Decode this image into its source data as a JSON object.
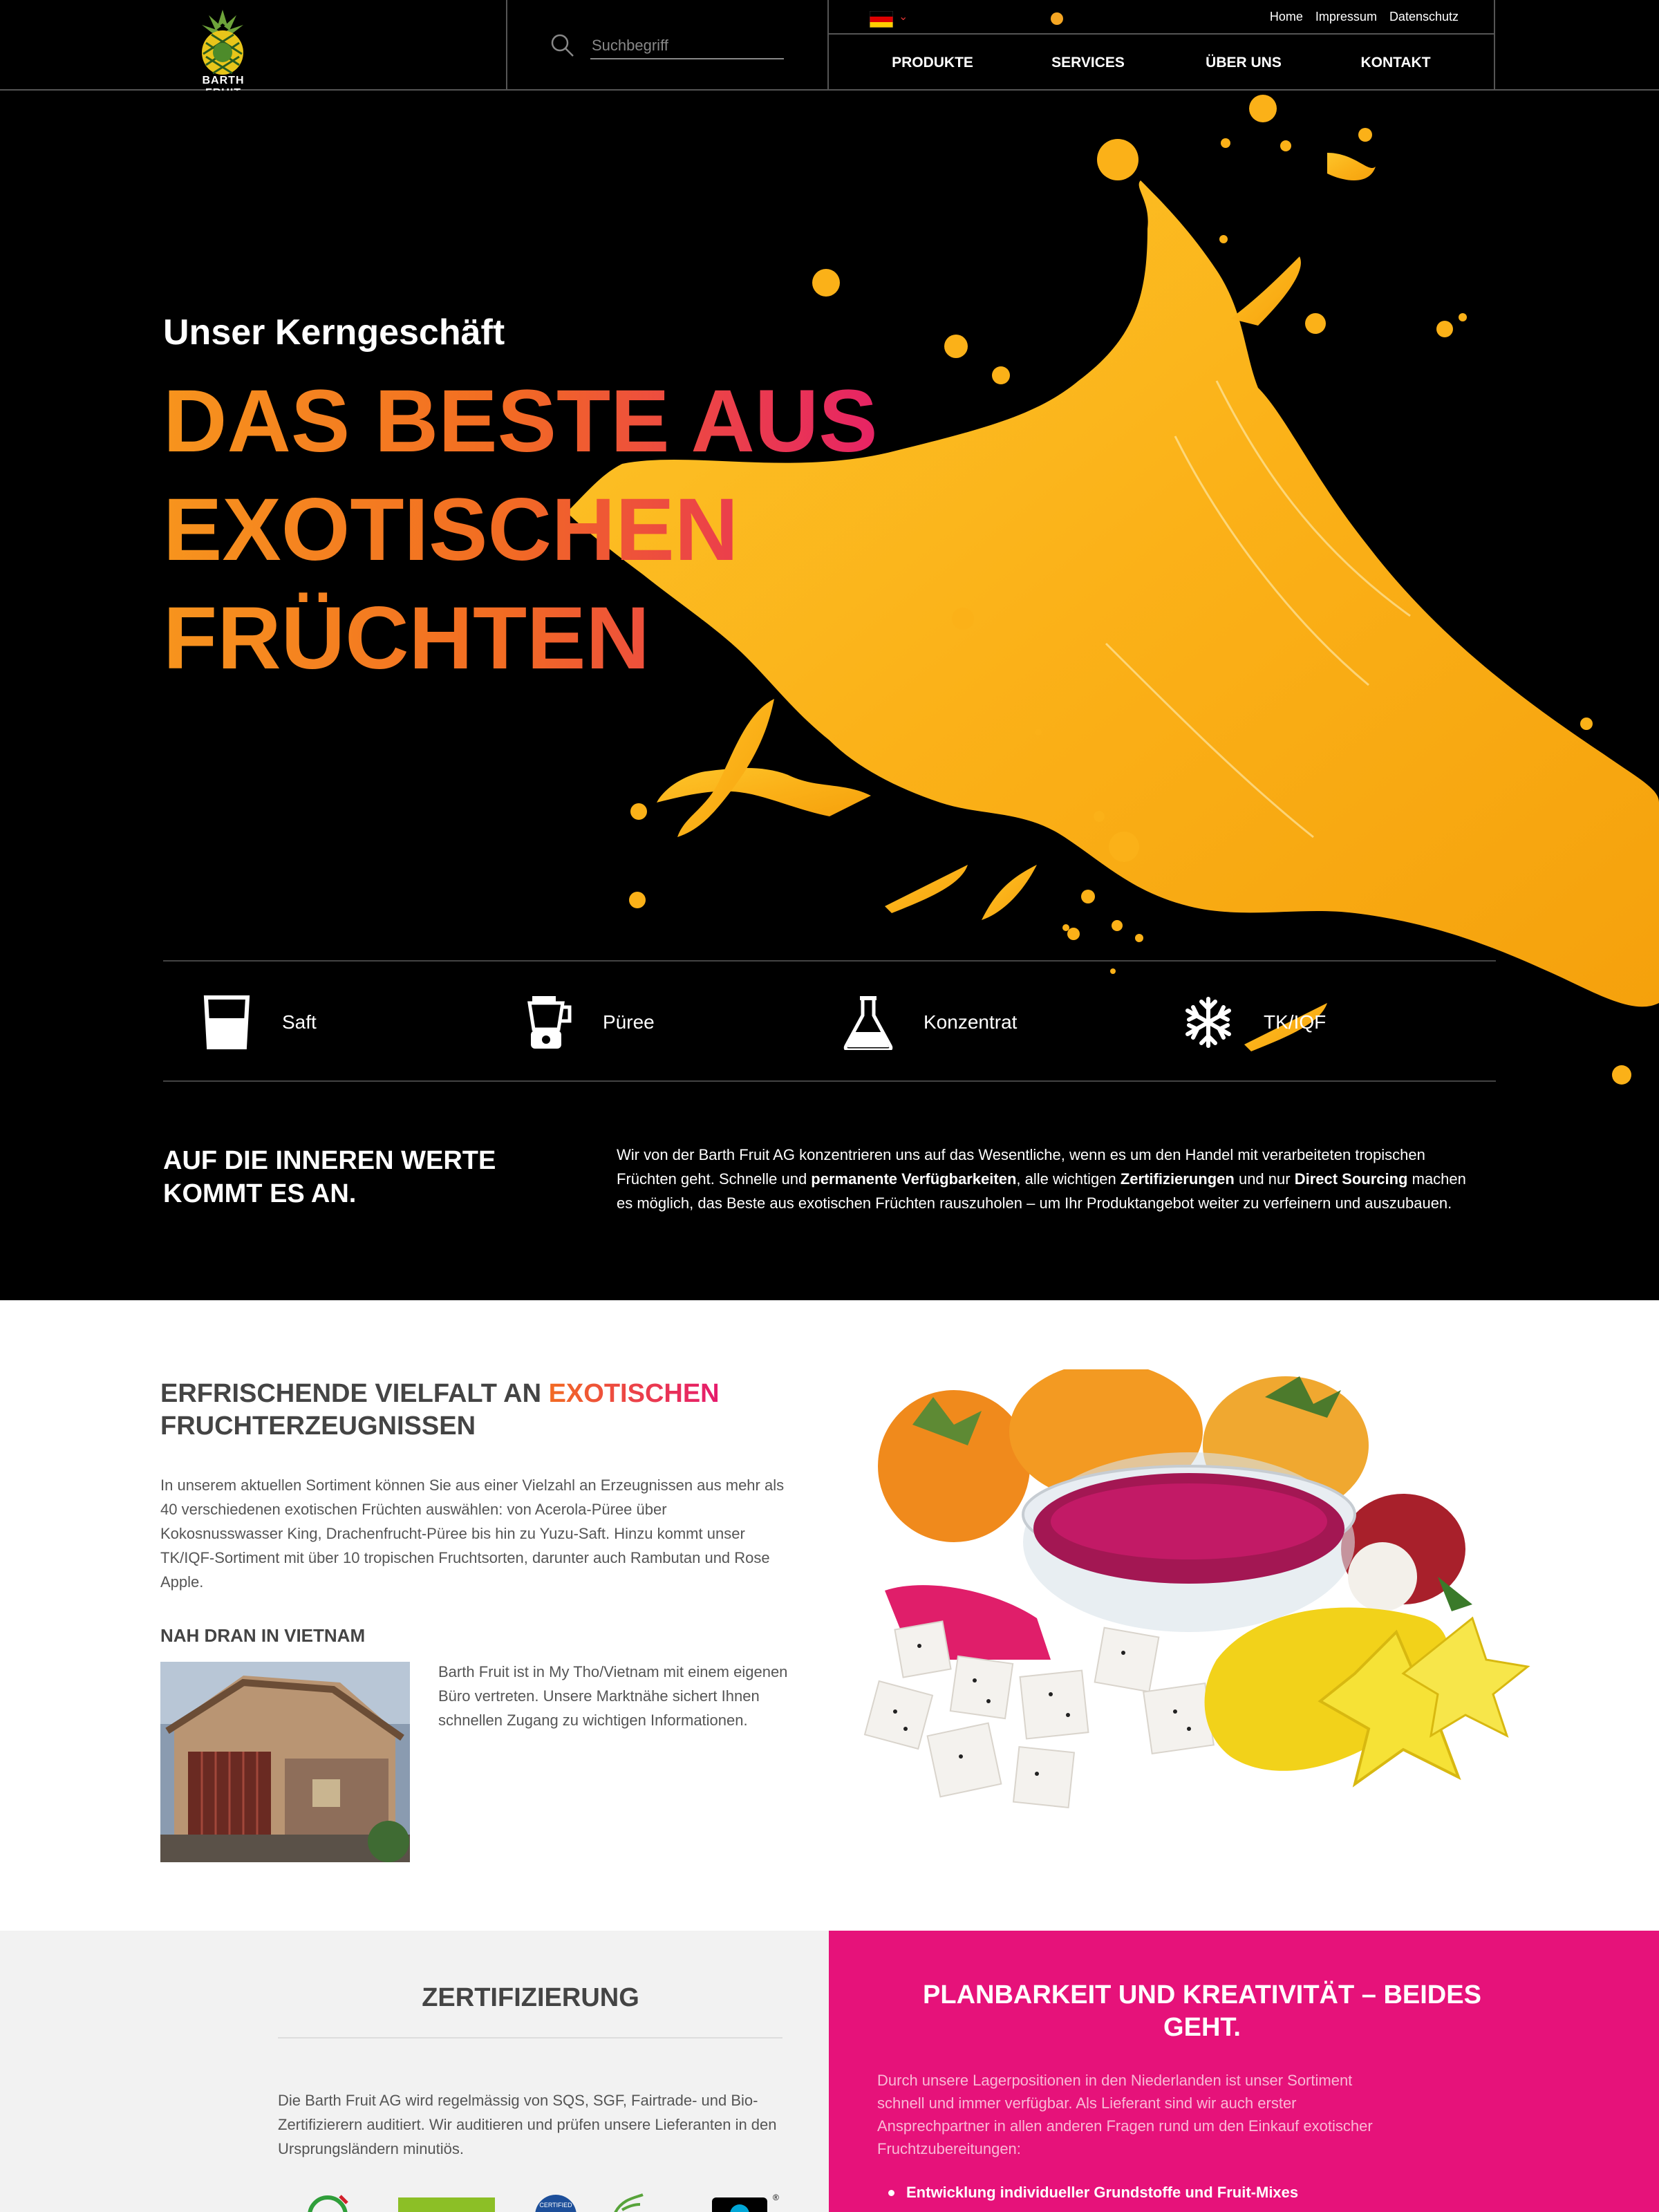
{
  "header": {
    "logo_text": "BARTH FRUIT",
    "search_placeholder": "Suchbegriff",
    "top_links": [
      "Home",
      "Impressum",
      "Datenschutz"
    ],
    "nav": [
      "PRODUKTE",
      "SERVICES",
      "ÜBER UNS",
      "KONTAKT"
    ]
  },
  "hero": {
    "subtitle": "Unser Kerngeschäft",
    "title_lines": [
      "DAS BESTE AUS",
      "EXOTISCHEN",
      "FRÜCHTEN"
    ]
  },
  "products": [
    {
      "label": "Saft",
      "icon": "glass-icon"
    },
    {
      "label": "Püree",
      "icon": "blender-icon"
    },
    {
      "label": "Konzentrat",
      "icon": "flask-icon"
    },
    {
      "label": "TK/IQF",
      "icon": "snowflake-icon"
    }
  ],
  "inner_values": {
    "heading": "AUF DIE INNEREN WERTE KOMMT ES AN.",
    "text_1": "Wir von der Barth Fruit AG konzentrieren uns auf das Wesentliche, wenn es um den Handel mit verarbeiteten tropischen Früchten geht. Schnelle und ",
    "bold_1": "permanente Verfügbarkeiten",
    "text_2": ", alle wichtigen ",
    "bold_2": "Zertifizierungen",
    "text_3": " und nur ",
    "bold_3": "Direct Sourcing",
    "text_4": " machen es möglich, das Beste aus exotischen Früchten rauszuholen – um Ihr Produktangebot weiter zu verfeinern und auszubauen."
  },
  "variety": {
    "heading_1": "ERFRISCHENDE VIELFALT AN ",
    "heading_highlight": "EXOTISCHEN",
    "heading_2": "FRUCHTERZEUGNISSEN",
    "text": "In unserem aktuellen Sortiment können Sie aus einer Vielzahl an Erzeugnissen aus mehr als 40 verschiedenen exotischen Früchten auswählen: von Acerola-Püree über Kokosnusswasser King, Drachenfrucht-Püree bis hin zu Yuzu-Saft. Hinzu kommt unser TK/IQF-Sortiment mit über 10 tropischen Fruchtsorten, darunter auch Rambutan und Rose Apple.",
    "vietnam_heading": "NAH DRAN IN VIETNAM",
    "vietnam_text": "Barth Fruit ist in My Tho/Vietnam mit einem eigenen Büro vertreten. Unsere Marktnähe sichert Ihnen schnellen Zugang zu wichtigen Informationen."
  },
  "certification": {
    "heading": "ZERTIFIZIERUNG",
    "text": "Die Barth Fruit AG wird regelmässig von SQS, SGF, Fairtrade- und Bio-Zertifizierern auditiert. Wir auditieren und prüfen unsere Lieferanten in den Ursprungsländern minutiös."
  },
  "planning": {
    "heading": "PLANBARKEIT UND KREATIVITÄT – BEIDES GEHT.",
    "text": "Durch unsere Lagerpositionen in den Niederlanden ist unser Sortiment schnell und immer verfügbar. Als Lieferant sind wir auch erster Ansprechpartner in allen anderen Fragen rund um den Einkauf exotischer Fruchtzubereitungen:",
    "bullet_1": "Entwicklung individueller Grundstoffe und Fruit-Mixes"
  },
  "colors": {
    "accent_orange": "#f26b23",
    "accent_pink": "#e6127a",
    "splash_yellow": "#fbb91b"
  }
}
